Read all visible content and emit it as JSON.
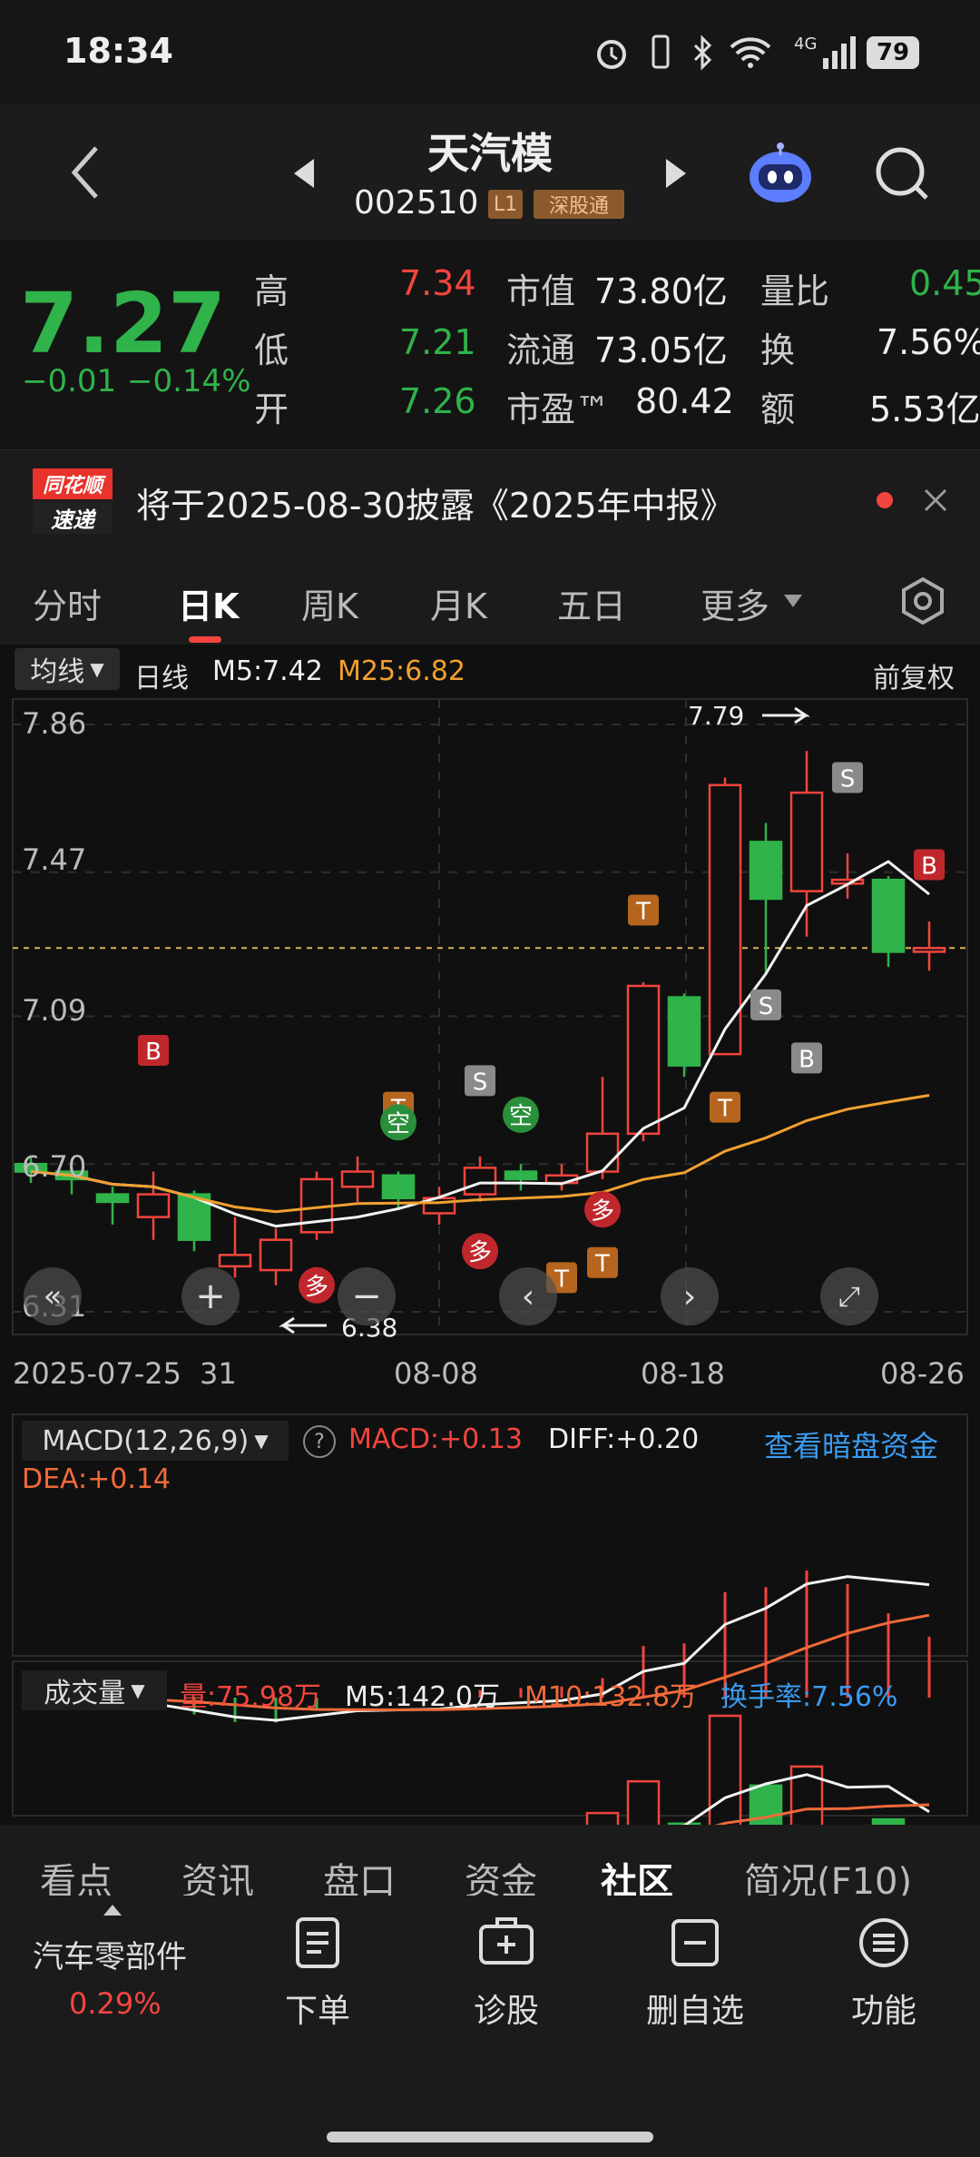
{
  "status_bar": {
    "time": "18:34",
    "network": "4G",
    "battery": "79"
  },
  "header": {
    "name": "天汽模",
    "code": "002510",
    "level_badge": "L1",
    "market_badge": "深股通"
  },
  "quote": {
    "price": "7.27",
    "change": "−0.01",
    "change_pct": "−0.14%",
    "high_label": "高",
    "high": "7.34",
    "low_label": "低",
    "low": "7.21",
    "open_label": "开",
    "open": "7.26",
    "mcap_label": "市值",
    "mcap": "73.80亿",
    "float_label": "流通",
    "float": "73.05亿",
    "pe_label": "市盈™",
    "pe": "80.42",
    "vol_ratio_label": "量比",
    "vol_ratio": "0.45",
    "turnover_label": "换",
    "turnover": "7.56%",
    "amount_label": "额",
    "amount": "5.53亿"
  },
  "notice": {
    "logo_top": "同花顺",
    "logo_bottom": "速递",
    "text": "将于2025-08-30披露《2025年中报》"
  },
  "tabs": [
    {
      "label": "分时",
      "active": false
    },
    {
      "label": "日K",
      "active": true
    },
    {
      "label": "周K",
      "active": false
    },
    {
      "label": "月K",
      "active": false
    },
    {
      "label": "五日",
      "active": false
    },
    {
      "label": "更多",
      "active": false
    }
  ],
  "kline_bar": {
    "indicator": "均线",
    "period": "日线",
    "m5": "M5:7.42",
    "m25": "M25:6.82",
    "adjust": "前复权"
  },
  "chart_data": {
    "type": "candlestick",
    "y_ticks": [
      "7.86",
      "7.47",
      "7.09",
      "6.70",
      "6.31"
    ],
    "ylim": [
      6.31,
      7.86
    ],
    "x_labels": [
      "2025-07-25",
      "31",
      "08-08",
      "08-18",
      "08-26"
    ],
    "max_label": "7.79",
    "min_label": "6.38",
    "candles": [
      {
        "o": 6.7,
        "c": 6.68,
        "h": 6.72,
        "l": 6.65
      },
      {
        "o": 6.68,
        "c": 6.66,
        "h": 6.69,
        "l": 6.62
      },
      {
        "o": 6.62,
        "c": 6.6,
        "h": 6.64,
        "l": 6.54
      },
      {
        "o": 6.56,
        "c": 6.62,
        "h": 6.68,
        "l": 6.5
      },
      {
        "o": 6.62,
        "c": 6.5,
        "h": 6.63,
        "l": 6.47
      },
      {
        "o": 6.43,
        "c": 6.46,
        "h": 6.56,
        "l": 6.4
      },
      {
        "o": 6.42,
        "c": 6.5,
        "h": 6.53,
        "l": 6.38
      },
      {
        "o": 6.52,
        "c": 6.66,
        "h": 6.68,
        "l": 6.5
      },
      {
        "o": 6.64,
        "c": 6.68,
        "h": 6.72,
        "l": 6.6
      },
      {
        "o": 6.67,
        "c": 6.61,
        "h": 6.68,
        "l": 6.58
      },
      {
        "o": 6.57,
        "c": 6.61,
        "h": 6.64,
        "l": 6.54
      },
      {
        "o": 6.62,
        "c": 6.69,
        "h": 6.72,
        "l": 6.6
      },
      {
        "o": 6.68,
        "c": 6.66,
        "h": 6.7,
        "l": 6.63
      },
      {
        "o": 6.65,
        "c": 6.67,
        "h": 6.7,
        "l": 6.63
      },
      {
        "o": 6.68,
        "c": 6.78,
        "h": 6.93,
        "l": 6.66
      },
      {
        "o": 6.78,
        "c": 7.17,
        "h": 7.18,
        "l": 6.76
      },
      {
        "o": 7.14,
        "c": 6.96,
        "h": 7.15,
        "l": 6.93
      },
      {
        "o": 6.99,
        "c": 7.7,
        "h": 7.72,
        "l": 6.99
      },
      {
        "o": 7.55,
        "c": 7.4,
        "h": 7.6,
        "l": 7.2
      },
      {
        "o": 7.42,
        "c": 7.68,
        "h": 7.79,
        "l": 7.3
      },
      {
        "o": 7.44,
        "c": 7.45,
        "h": 7.52,
        "l": 7.4
      },
      {
        "o": 7.45,
        "c": 7.26,
        "h": 7.46,
        "l": 7.22
      },
      {
        "o": 7.26,
        "c": 7.27,
        "h": 7.34,
        "l": 7.21
      }
    ],
    "macd": {
      "label": "MACD(12,26,9)",
      "macd": "MACD:+0.13",
      "diff": "DIFF:+0.20",
      "dea": "DEA:+0.14",
      "link": "查看暗盘资金"
    },
    "volume": {
      "label": "成交量",
      "vol": "量:75.98万",
      "m5": "M5:142.0万",
      "m10": "M10:132.8万",
      "turnover": "换手率:7.56%"
    }
  },
  "chart_markers": [
    "B",
    "S",
    "T",
    "空",
    "多"
  ],
  "lower_tabs": [
    "看点",
    "资讯",
    "盘口",
    "资金",
    "社区",
    "简况(F10)"
  ],
  "bottom_nav": {
    "sector": "汽车零部件",
    "sector_pct": "0.29%",
    "items": [
      "下单",
      "诊股",
      "删自选",
      "功能"
    ]
  },
  "colors": {
    "up": "#f2453d",
    "down": "#2fb34a",
    "m25": "#f0a030",
    "accent": "#3a9bf0"
  }
}
